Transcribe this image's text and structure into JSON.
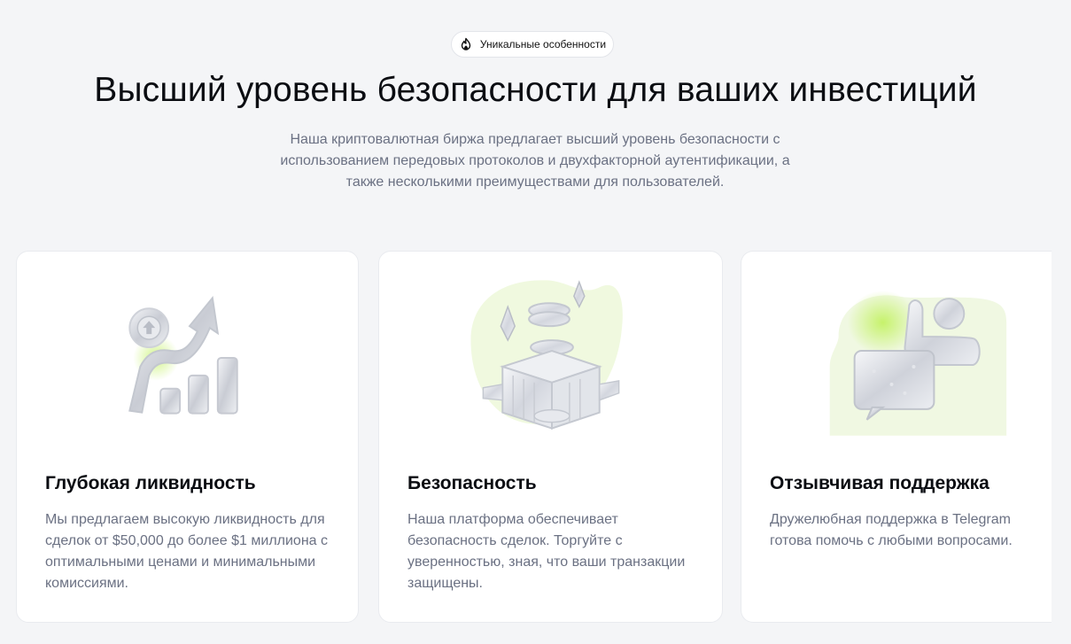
{
  "badge": {
    "icon": "flame-icon",
    "label": "Уникальные особенности"
  },
  "headline": "Высший уровень безопасности для ваших инвестиций",
  "subtitle": "Наша криптовалютная биржа предлагает высший уровень безопасности с использованием передовых протоколов и двухфакторной аутентификации, а также несколькими преимуществами для пользователей.",
  "features": [
    {
      "icon": "growth-chart-illustration",
      "title": "Глубокая ликвидность",
      "description": "Мы предлагаем высокую ликвидность для сделок от $50,000 до более $1 миллиона с оптимальными ценами и минимальными комиссиями."
    },
    {
      "icon": "secure-box-illustration",
      "title": "Безопасность",
      "description": "Наша платформа обеспечивает безопасность сделок. Торгуйте с уверенностью, зная, что ваши транзакции защищены."
    },
    {
      "icon": "support-chat-illustration",
      "title": "Отзывчивая поддержка",
      "description": "Дружелюбная поддержка в Telegram готова помочь с любыми вопросами."
    }
  ],
  "colors": {
    "background": "#f4f5f7",
    "card": "#ffffff",
    "accent_green": "#c6f26b",
    "text_muted": "#6b7183"
  }
}
